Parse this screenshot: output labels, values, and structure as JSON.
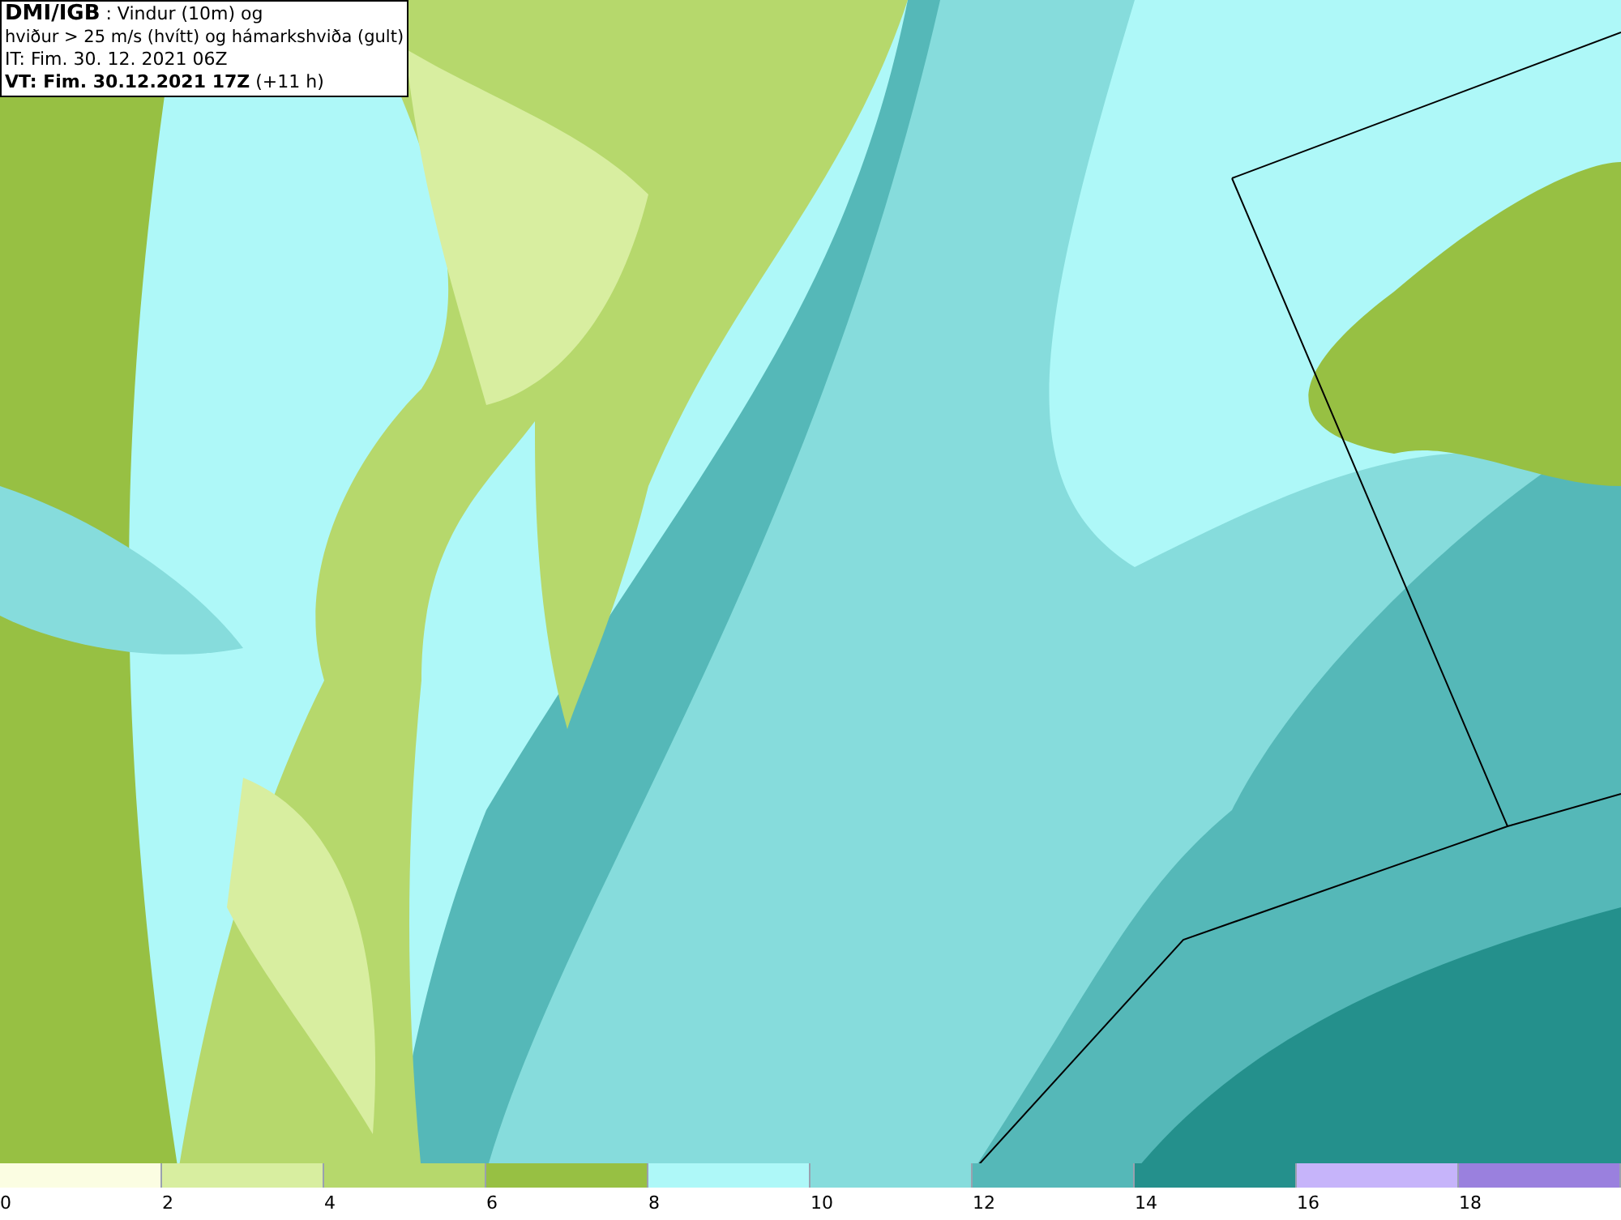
{
  "header": {
    "source": "DMI/IGB",
    "title": ": Vindur (10m) og",
    "subtitle": "hviður > 25 m/s (hvítt) og hámarkshviða (gult)",
    "initial_time": "IT: Fim. 30. 12. 2021 06Z",
    "valid_time": "VT: Fim. 30.12.2021 17Z",
    "offset": "(+11 h)"
  },
  "legend": [
    {
      "label": "0",
      "color": "#fbfde2"
    },
    {
      "label": "2",
      "color": "#d8eea0"
    },
    {
      "label": "4",
      "color": "#b6d86c"
    },
    {
      "label": "6",
      "color": "#97c043"
    },
    {
      "label": "8",
      "color": "#aef8f8"
    },
    {
      "label": "10",
      "color": "#86dcdc"
    },
    {
      "label": "12",
      "color": "#55b8b8"
    },
    {
      "label": "14",
      "color": "#24908c"
    },
    {
      "label": "16",
      "color": "#c6b4fa"
    },
    {
      "label": "18",
      "color": "#9a80de"
    }
  ]
}
